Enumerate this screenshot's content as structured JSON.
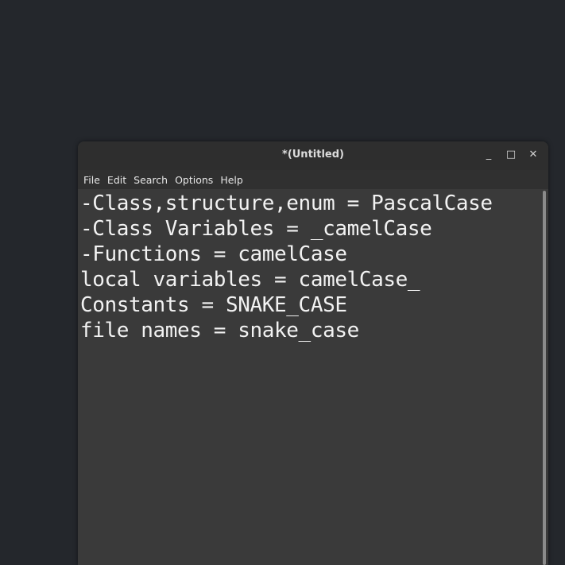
{
  "window": {
    "title": "*(Untitled)",
    "controls": {
      "minimize": "_",
      "maximize": "□",
      "close": "✕"
    }
  },
  "menubar": {
    "items": [
      {
        "label": "File"
      },
      {
        "label": "Edit"
      },
      {
        "label": "Search"
      },
      {
        "label": "Options"
      },
      {
        "label": "Help"
      }
    ]
  },
  "editor": {
    "lines": [
      "-Class,structure,enum = PascalCase",
      "-Class Variables = _camelCase",
      "-Functions = camelCase",
      "local variables = camelCase_",
      "Constants = SNAKE_CASE",
      "file names = snake_case"
    ]
  }
}
